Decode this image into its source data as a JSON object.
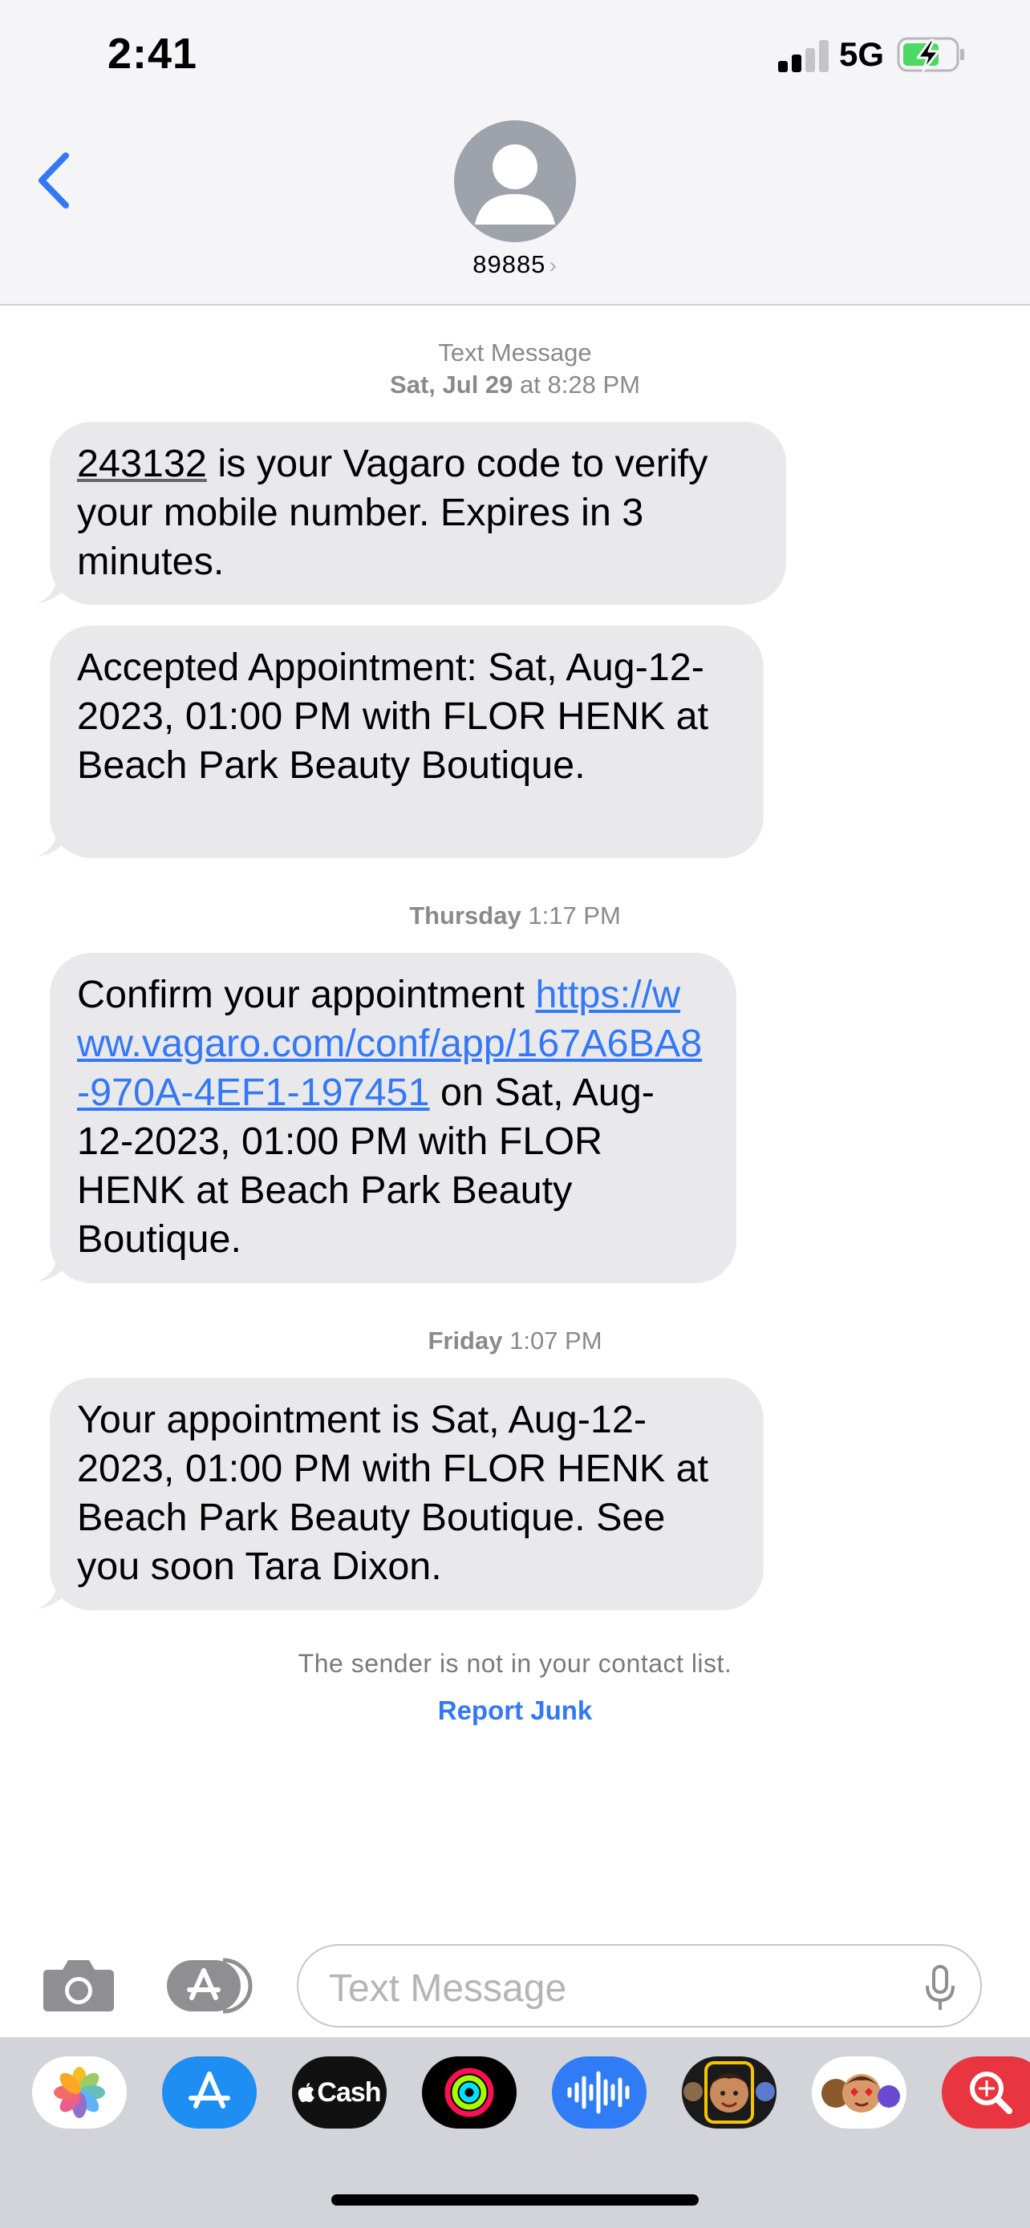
{
  "status_bar": {
    "time": "2:41",
    "network": "5G",
    "battery_state": "charging",
    "colors": {
      "battery_fill": "#4cd964"
    }
  },
  "header": {
    "contact": "89885",
    "back_icon": "chevron-left-icon",
    "avatar_icon": "person-silhouette-icon"
  },
  "conversation": {
    "header_type": "Text Message",
    "header_date": "Sat, Jul 29",
    "header_time": "at 8:28 PM",
    "messages": [
      {
        "code": "243132",
        "text": " is your Vagaro code to verify your mobile number. Expires in 3 minutes."
      },
      {
        "text": "Accepted Appointment: Sat, Aug-12-2023, 01:00 PM  with FLOR HENK at Beach Park Beauty Boutique."
      },
      {
        "timestamp_day": "Thursday",
        "timestamp_time": "1:17 PM",
        "prefix": "Confirm your appointment ",
        "url": "https://www.vagaro.com/conf/app/167A6BA8-970A-4EF1-197451",
        "suffix": " on Sat, Aug-12-2023, 01:00 PM  with FLOR HENK at Beach Park Beauty Boutique."
      },
      {
        "timestamp_day": "Friday",
        "timestamp_time": "1:07 PM",
        "text": "Your appointment is Sat, Aug-12-2023, 01:00 PM  with FLOR HENK at Beach Park Beauty Boutique. See you soon Tara Dixon."
      }
    ],
    "not_in_contacts": "The sender is not in your contact list.",
    "report_junk": "Report Junk"
  },
  "input_bar": {
    "placeholder": "Text Message",
    "camera_icon": "camera-icon",
    "apps_icon": "app-store-icon",
    "mic_icon": "microphone-icon"
  },
  "app_drawer": {
    "apps": [
      {
        "name": "photos-app-icon"
      },
      {
        "name": "app-store-app-icon"
      },
      {
        "name": "apple-cash-app-icon",
        "label": "Cash"
      },
      {
        "name": "activity-app-icon"
      },
      {
        "name": "audio-message-app-icon"
      },
      {
        "name": "memoji-app-icon"
      },
      {
        "name": "memoji-stickers-app-icon"
      },
      {
        "name": "image-search-app-icon"
      }
    ]
  },
  "colors": {
    "accent": "#3478f6",
    "bubble": "#e9e9eb",
    "header_bg": "#f5f5f7",
    "drawer_bg": "#d2d4d9"
  }
}
